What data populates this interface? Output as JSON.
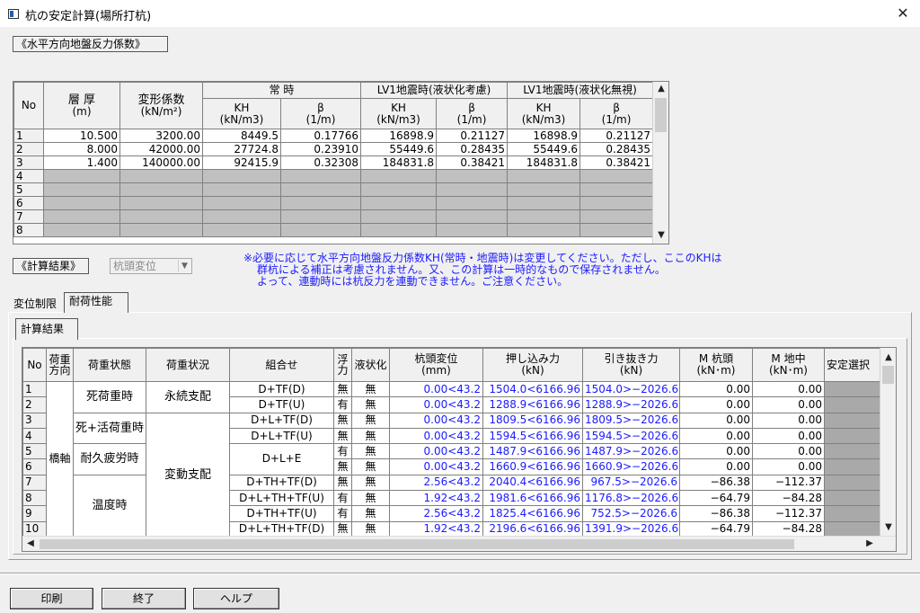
{
  "window": {
    "title": "杭の安定計算(場所打杭)",
    "close": "✕"
  },
  "section1_label": "《水平方向地盤反力係数》",
  "top_table": {
    "head_no": "No",
    "head_thick": "層 厚",
    "head_thick_unit": "(m)",
    "head_mod": "変形係数",
    "head_mod_unit": "(kN/m²)",
    "grp_normal": "常 時",
    "grp_lv1a": "LV1地震時(液状化考慮)",
    "grp_lv1b": "LV1地震時(液状化無視)",
    "sub_kh": "KH",
    "sub_kh_unit": "(kN/m3)",
    "sub_beta": "β",
    "sub_beta_unit": "(1/m)",
    "rows": [
      [
        "1",
        "10.500",
        "3200.00",
        "8449.5",
        "0.17766",
        "16898.9",
        "0.21127",
        "16898.9",
        "0.21127"
      ],
      [
        "2",
        "8.000",
        "42000.00",
        "27724.8",
        "0.23910",
        "55449.6",
        "0.28435",
        "55449.6",
        "0.28435"
      ],
      [
        "3",
        "1.400",
        "140000.00",
        "92415.9",
        "0.32308",
        "184831.8",
        "0.38421",
        "184831.8",
        "0.38421"
      ]
    ],
    "empty_rows": [
      "4",
      "5",
      "6",
      "7",
      "8"
    ]
  },
  "section2_label": "《計算結果》",
  "combo": {
    "value": "杭頭変位",
    "arrow": "▼"
  },
  "note": [
    "※必要に応じて水平方向地盤反力係数KH(常時・地震時)は変更してください。ただし、ここのKHは",
    "群杭による補正は考慮されません。又、この計算は一時的なもので保存されません。",
    "よって、連動時には杭反力を連動できません。ご注意ください。"
  ],
  "tabs": {
    "t1": "変位制限",
    "t2": "耐荷性能",
    "inner": "計算結果"
  },
  "bottom_table": {
    "headers": [
      "No",
      "荷重方向",
      "荷重状態",
      "荷重状況",
      "組合せ",
      "浮力",
      "液状化",
      "杭頭変位",
      "(mm)",
      "押し込み力",
      "(kN)",
      "引き抜き力",
      "(kN)",
      "M 杭頭",
      "(kN･m)",
      "M 地中",
      "(kN･m)",
      "安定選択"
    ],
    "dir": "橋軸",
    "states": {
      "s1": "死荷重時",
      "s2": "死+活荷重時",
      "s3": "耐久疲労時",
      "s4": "温度時"
    },
    "situations": {
      "p": "永続支配",
      "v": "変動支配"
    },
    "rows": [
      [
        "1",
        "D+TF(D)",
        "無",
        "無",
        "0.00<43.2",
        "1504.0<6166.96",
        "1504.0>−2026.6",
        "0.00",
        "0.00"
      ],
      [
        "2",
        "D+TF(U)",
        "有",
        "無",
        "0.00<43.2",
        "1288.9<6166.96",
        "1288.9>−2026.6",
        "0.00",
        "0.00"
      ],
      [
        "3",
        "D+L+TF(D)",
        "無",
        "無",
        "0.00<43.2",
        "1809.5<6166.96",
        "1809.5>−2026.6",
        "0.00",
        "0.00"
      ],
      [
        "4",
        "D+L+TF(U)",
        "無",
        "無",
        "0.00<43.2",
        "1594.5<6166.96",
        "1594.5>−2026.6",
        "0.00",
        "0.00"
      ],
      [
        "5",
        "D+L+E",
        "有",
        "無",
        "0.00<43.2",
        "1487.9<6166.96",
        "1487.9>−2026.6",
        "0.00",
        "0.00"
      ],
      [
        "6",
        "",
        "無",
        "無",
        "0.00<43.2",
        "1660.9<6166.96",
        "1660.9>−2026.6",
        "0.00",
        "0.00"
      ],
      [
        "7",
        "D+TH+TF(D)",
        "無",
        "無",
        "2.56<43.2",
        "2040.4<6166.96",
        "967.5>−2026.6",
        "−86.38",
        "−112.37"
      ],
      [
        "8",
        "D+L+TH+TF(U)",
        "有",
        "無",
        "1.92<43.2",
        "1981.6<6166.96",
        "1176.8>−2026.6",
        "−64.79",
        "−84.28"
      ],
      [
        "9",
        "D+TH+TF(U)",
        "有",
        "無",
        "2.56<43.2",
        "1825.4<6166.96",
        "752.5>−2026.6",
        "−86.38",
        "−112.37"
      ],
      [
        "10",
        "D+L+TH+TF(D)",
        "無",
        "無",
        "1.92<43.2",
        "2196.6<6166.96",
        "1391.9>−2026.6",
        "−64.79",
        "−84.28"
      ]
    ]
  },
  "buttons": {
    "print": "印刷",
    "end": "終了",
    "help": "ヘルプ"
  },
  "scroll": {
    "up": "▲",
    "down": "▼",
    "left": "◀",
    "right": "▶"
  }
}
